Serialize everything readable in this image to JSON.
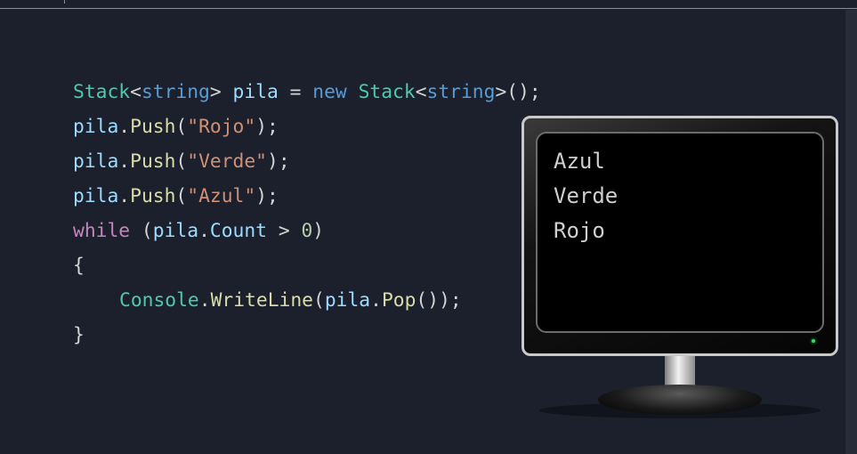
{
  "code": {
    "l1": {
      "type1": "Stack",
      "lt1": "<",
      "kw1": "string",
      "gt1": ">",
      "var": " pila",
      "eq": " = ",
      "kwnew": "new",
      "type2": " Stack",
      "lt2": "<",
      "kw2": "string",
      "gt2": ">",
      "end": "();"
    },
    "l2": {
      "obj": "pila",
      "dot": ".",
      "method": "Push",
      "open": "(",
      "arg": "\"Rojo\"",
      "close": ");"
    },
    "l3": {
      "obj": "pila",
      "dot": ".",
      "method": "Push",
      "open": "(",
      "arg": "\"Verde\"",
      "close": ");"
    },
    "l4": {
      "obj": "pila",
      "dot": ".",
      "method": "Push",
      "open": "(",
      "arg": "\"Azul\"",
      "close": ");"
    },
    "l5": {
      "kw": "while",
      "open": " (",
      "obj": "pila",
      "dot": ".",
      "prop": "Count",
      "op": " > ",
      "num": "0",
      "close": ")"
    },
    "l6": {
      "brace": "{"
    },
    "l7": {
      "cls": "Console",
      "dot1": ".",
      "method": "WriteLine",
      "open": "(",
      "obj": "pila",
      "dot2": ".",
      "method2": "Pop",
      "close": "());"
    },
    "l8": {
      "brace": "}"
    }
  },
  "console": {
    "lines": [
      "Azul",
      "Verde",
      "Rojo"
    ]
  },
  "colors": {
    "background": "#1b202c",
    "type": "#4ec9b0",
    "keyword": "#569cd6",
    "variable": "#9cdcfe",
    "method": "#dcdcaa",
    "string": "#ce9178",
    "control": "#c586c0",
    "number": "#b5cea8"
  }
}
